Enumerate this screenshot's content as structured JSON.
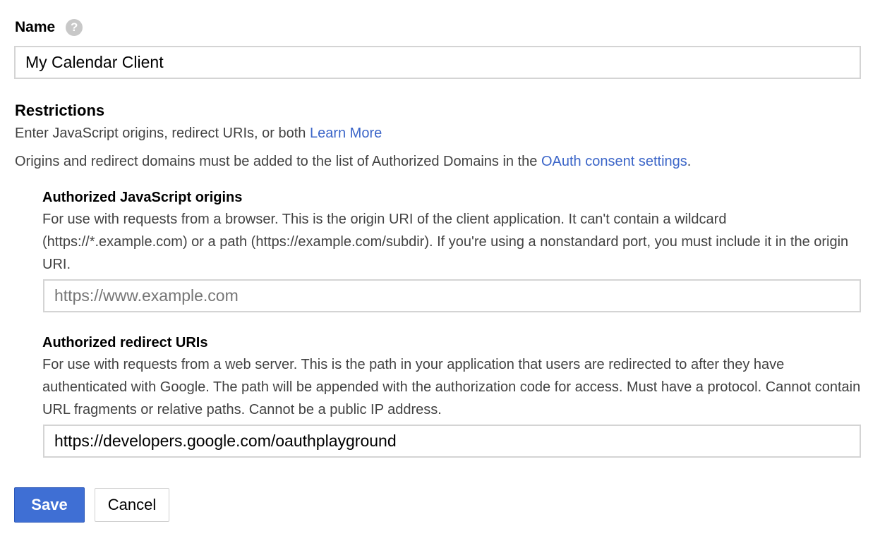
{
  "name_field": {
    "label": "Name",
    "help_icon_glyph": "?",
    "value": "My Calendar Client"
  },
  "restrictions": {
    "title": "Restrictions",
    "intro_text": "Enter JavaScript origins, redirect URIs, or both",
    "learn_more_link": "Learn More",
    "domains_text": "Origins and redirect domains must be added to the list of Authorized Domains in the",
    "consent_link": "OAuth consent settings",
    "domains_suffix": "."
  },
  "origins": {
    "title": "Authorized JavaScript origins",
    "description": "For use with requests from a browser. This is the origin URI of the client application. It can't contain a wildcard (https://*.example.com) or a path (https://example.com/subdir). If you're using a nonstandard port, you must include it in the origin URI.",
    "value": "",
    "placeholder": "https://www.example.com"
  },
  "redirects": {
    "title": "Authorized redirect URIs",
    "description": "For use with requests from a web server. This is the path in your application that users are redirected to after they have authenticated with Google. The path will be appended with the authorization code for access. Must have a protocol. Cannot contain URL fragments or relative paths. Cannot be a public IP address.",
    "value": "https://developers.google.com/oauthplayground",
    "placeholder": ""
  },
  "actions": {
    "save_label": "Save",
    "cancel_label": "Cancel"
  },
  "colors": {
    "link": "#3b65c8",
    "primary_button": "#3f6fd4",
    "help_icon": "#c8c8c8"
  },
  "icons": {
    "help": "help-icon"
  }
}
